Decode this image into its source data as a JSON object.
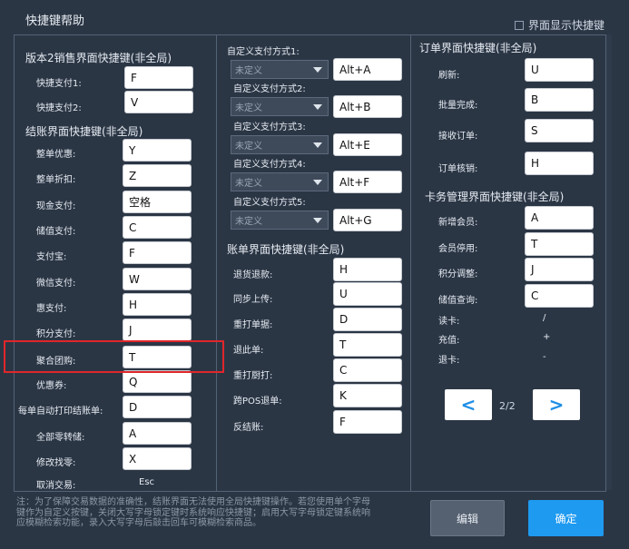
{
  "window": {
    "title": "快捷键帮助",
    "show_on_screen_label": "界面显示快捷键"
  },
  "left": {
    "sec1_title": "版本2销售界面快捷键(非全局)",
    "sec1": [
      {
        "label": "快捷支付1:",
        "value": "F"
      },
      {
        "label": "快捷支付2:",
        "value": "V"
      }
    ],
    "sec2_title": "结账界面快捷键(非全局)",
    "sec2": [
      {
        "label": "整单优惠:",
        "value": "Y"
      },
      {
        "label": "整单折扣:",
        "value": "Z"
      },
      {
        "label": "现金支付:",
        "value": "空格"
      },
      {
        "label": "储值支付:",
        "value": "C"
      },
      {
        "label": "支付宝:",
        "value": "F"
      },
      {
        "label": "微信支付:",
        "value": "W"
      },
      {
        "label": "惠支付:",
        "value": "H"
      },
      {
        "label": "积分支付:",
        "value": "J"
      },
      {
        "label": "聚合团购:",
        "value": "T"
      },
      {
        "label": "优惠券:",
        "value": "Q"
      },
      {
        "label": "每单自动打印结账单:",
        "value": "D"
      },
      {
        "label": "全部零转储:",
        "value": "A"
      },
      {
        "label": "修改找零:",
        "value": "X"
      }
    ],
    "cancel": {
      "label": "取消交易:",
      "value": "Esc"
    }
  },
  "middle": {
    "custom": [
      {
        "label": "自定义支付方式1:",
        "select": "未定义",
        "value": "Alt+A"
      },
      {
        "label": "自定义支付方式2:",
        "select": "未定义",
        "value": "Alt+B"
      },
      {
        "label": "自定义支付方式3:",
        "select": "未定义",
        "value": "Alt+E"
      },
      {
        "label": "自定义支付方式4:",
        "select": "未定义",
        "value": "Alt+F"
      },
      {
        "label": "自定义支付方式5:",
        "select": "未定义",
        "value": "Alt+G"
      }
    ],
    "bill_title": "账单界面快捷键(非全局)",
    "bill": [
      {
        "label": "退货退款:",
        "value": "H"
      },
      {
        "label": "同步上传:",
        "value": "U"
      },
      {
        "label": "重打单据:",
        "value": "D"
      },
      {
        "label": "退此单:",
        "value": "T"
      },
      {
        "label": "重打厨打:",
        "value": "C"
      },
      {
        "label": "跨POS退单:",
        "value": "K"
      },
      {
        "label": "反结账:",
        "value": "F"
      }
    ]
  },
  "right": {
    "order_title": "订单界面快捷键(非全局)",
    "order": [
      {
        "label": "刷新:",
        "value": "U"
      },
      {
        "label": "批量完成:",
        "value": "B"
      },
      {
        "label": "接收订单:",
        "value": "S"
      },
      {
        "label": "订单核销:",
        "value": "H"
      }
    ],
    "card_title": "卡务管理界面快捷键(非全局)",
    "card": [
      {
        "label": "新增会员:",
        "value": "A"
      },
      {
        "label": "会员停用:",
        "value": "T"
      },
      {
        "label": "积分调整:",
        "value": "J"
      },
      {
        "label": "储值查询:",
        "value": "C"
      }
    ],
    "card_static": [
      {
        "label": "读卡:",
        "value": "/"
      },
      {
        "label": "充值:",
        "value": "+"
      },
      {
        "label": "退卡:",
        "value": "-"
      }
    ],
    "pager": {
      "text": "2/2",
      "prev": "<",
      "next": ">"
    }
  },
  "footer": {
    "note_lines": [
      "注：为了保障交易数据的准确性，结账界面无法使用全局快捷键操作。若您使用单个字母",
      "键作为自定义按键，关闭大写字母锁定键时系统响应快捷键；启用大写字母锁定键系统响",
      "应模糊检索功能，录入大写字母后敲击回车可模糊检索商品。"
    ],
    "edit_label": "编辑",
    "ok_label": "确定"
  },
  "colors": {
    "background": "#2b3645",
    "accent": "#1e9af0",
    "highlight": "#e0262a"
  }
}
